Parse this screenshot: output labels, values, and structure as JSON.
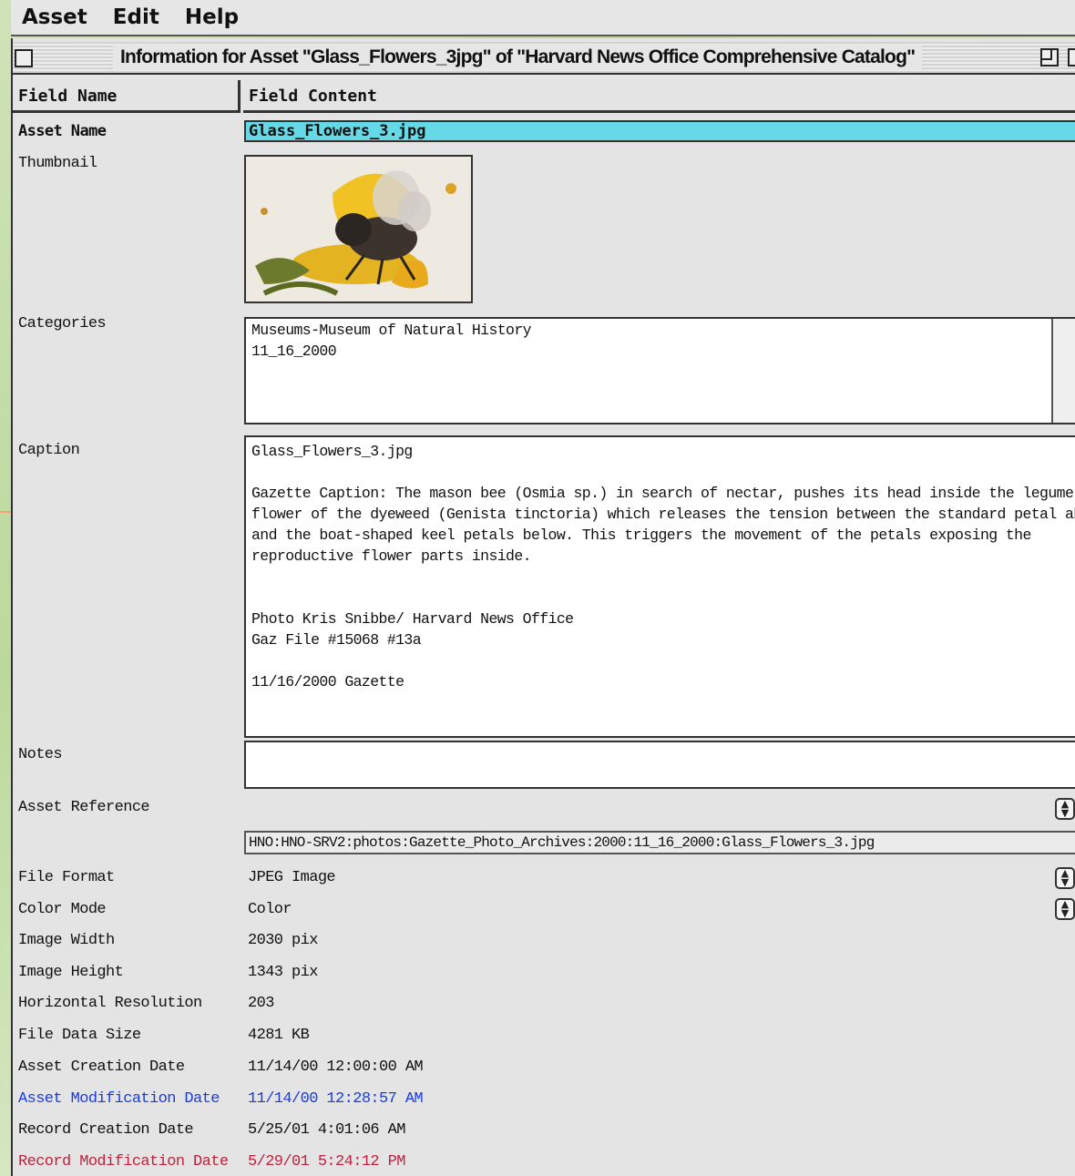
{
  "menu": {
    "items": [
      "Asset",
      "Edit",
      "Help"
    ]
  },
  "window": {
    "title": "Information for Asset \"Glass_Flowers_3jpg\" of \"Harvard News Office Comprehensive Catalog\""
  },
  "header": {
    "field_name": "Field Name",
    "field_content": "Field Content"
  },
  "fields": {
    "asset_name": {
      "label": "Asset Name",
      "value": "Glass_Flowers_3.jpg"
    },
    "thumbnail": {
      "label": "Thumbnail"
    },
    "categories": {
      "label": "Categories",
      "lines": [
        "Museums-Museum of Natural History",
        "11_16_2000"
      ]
    },
    "caption": {
      "label": "Caption",
      "lines": [
        "Glass_Flowers_3.jpg",
        "Gazette Caption: The mason bee (Osmia sp.) in search of nectar, pushes its head inside the legume",
        "flower of the dyeweed (Genista tinctoria)  which releases the tension between the standard petal above",
        "and the boat-shaped keel petals below.  This triggers the movement of the petals exposing the",
        "reproductive flower parts inside.",
        "Photo Kris Snibbe/ Harvard News Office",
        "Gaz File #15068 #13a",
        "11/16/2000 Gazette"
      ]
    },
    "notes": {
      "label": "Notes",
      "value": ""
    },
    "asset_reference": {
      "label": "Asset Reference",
      "value": "HNO:HNO-SRV2:photos:Gazette_Photo_Archives:2000:11_16_2000:Glass_Flowers_3.jpg"
    },
    "file_format": {
      "label": "File Format",
      "value": "JPEG Image"
    },
    "color_mode": {
      "label": "Color Mode",
      "value": "Color"
    },
    "image_width": {
      "label": "Image Width",
      "value": "2030 pix"
    },
    "image_height": {
      "label": "Image Height",
      "value": "1343 pix"
    },
    "horizontal_resolution": {
      "label": "Horizontal Resolution",
      "value": "203"
    },
    "file_data_size": {
      "label": "File Data Size",
      "value": "4281 KB"
    },
    "asset_creation_date": {
      "label": "Asset Creation Date",
      "value": "11/14/00 12:00:00 AM"
    },
    "asset_modification_date": {
      "label": "Asset Modification Date",
      "value": "11/14/00 12:28:57 AM"
    },
    "record_creation_date": {
      "label": "Record Creation Date",
      "value": "5/25/01 4:01:06 AM"
    },
    "record_modification_date": {
      "label": "Record Modification Date",
      "value": "5/29/01 5:24:12 PM"
    }
  },
  "colors": {
    "highlight": "#66d9e6",
    "blue_text": "#1a3be0",
    "red_text": "#c0213f",
    "arrow": "#f2a36c"
  }
}
